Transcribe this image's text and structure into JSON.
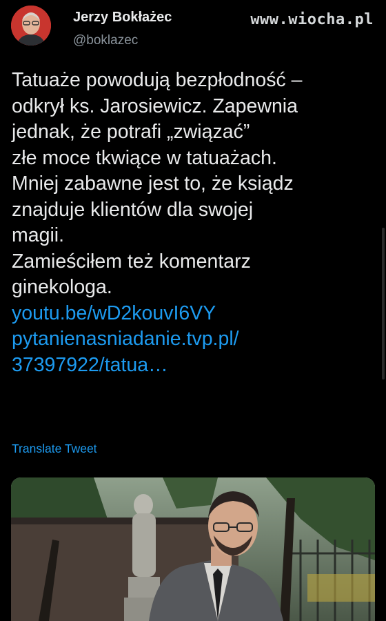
{
  "author": {
    "name": "Jerzy Bokłażec",
    "handle": "@boklazec"
  },
  "watermark": "www.wiocha.pl",
  "tweet": {
    "lines": [
      "Tatuaże powodują bezpłodność –",
      "odkrył ks. Jarosiewicz. Zapewnia",
      "jednak, że potrafi „związać”",
      "złe moce tkwiące w tatuażach.",
      "Mniej zabawne jest to, że ksiądz",
      "znajduje klientów dla swojej",
      "magii.",
      "Zamieściłem też komentarz",
      "ginekologa."
    ],
    "links": [
      "youtu.be/wD2kouvI6VY",
      "pytanienasniadanie.tvp.pl/",
      "37397922/tatua…"
    ],
    "translate_label": "Translate Tweet"
  },
  "colors": {
    "background": "#000000",
    "text": "#e9eaeb",
    "link": "#1d9bf0",
    "secondary": "#8b949c"
  },
  "media": {
    "kind": "video-thumbnail"
  }
}
